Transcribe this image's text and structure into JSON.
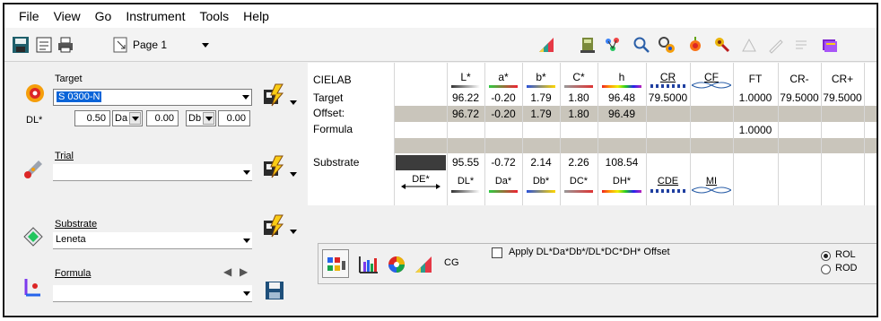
{
  "menu": [
    "File",
    "View",
    "Go",
    "Instrument",
    "Tools",
    "Help"
  ],
  "toolbar": {
    "page_label": "Page 1"
  },
  "target": {
    "label": "Target",
    "value": "S 0300-N",
    "dl_label": "DL*",
    "dl_value": "0.50",
    "da_select": "Da",
    "da_value": "0.00",
    "db_select": "Db",
    "db_value": "0.00"
  },
  "trial": {
    "label": "Trial",
    "value": ""
  },
  "substrate": {
    "label": "Substrate",
    "value": "Leneta"
  },
  "formula": {
    "label": "Formula",
    "value": ""
  },
  "grid": {
    "headers": [
      "CIELAB",
      "",
      "L*",
      "a*",
      "b*",
      "C*",
      "h",
      "CR",
      "CF",
      "FT",
      "CR-",
      "CR+"
    ],
    "rows": [
      {
        "label": "Target",
        "values": [
          "96.22",
          "-0.20",
          "1.79",
          "1.80",
          "96.48",
          "79.5000",
          "",
          "1.0000",
          "79.5000",
          "79.5000"
        ]
      },
      {
        "label": "Offset:",
        "values": [
          "96.72",
          "-0.20",
          "1.79",
          "1.80",
          "96.49",
          "",
          "",
          "",
          "",
          ""
        ]
      },
      {
        "label": "Formula",
        "values": [
          "",
          "",
          "",
          "",
          "",
          "",
          "",
          "1.0000",
          "",
          ""
        ]
      },
      {
        "label": "Substrate",
        "values": [
          "95.55",
          "-0.72",
          "2.14",
          "2.26",
          "108.54",
          "",
          "",
          "",
          "",
          ""
        ]
      }
    ],
    "diff_headers": [
      "DE*",
      "DL*",
      "Da*",
      "Db*",
      "DC*",
      "DH*",
      "CDE",
      "MI"
    ]
  },
  "tools": {
    "cg_label": "CG",
    "apply_offset_label": "Apply DL*Da*Db*/DL*DC*DH* Offset",
    "rol_label": "ROL",
    "rod_label": "ROD"
  },
  "colors": {
    "selection": "#0a64d8",
    "band": "#c9c5bb",
    "substrate_swatch": "#3c3c3c"
  }
}
